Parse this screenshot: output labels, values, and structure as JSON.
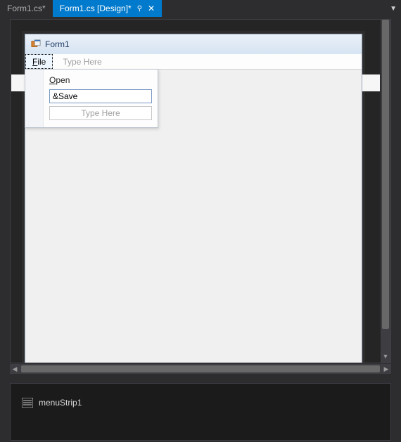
{
  "tabs": {
    "inactive": "Form1.cs*",
    "active": "Form1.cs [Design]*"
  },
  "form": {
    "title": "Form1"
  },
  "menustrip": {
    "file_prefix": "F",
    "file_label": "ile",
    "placeholder": "Type Here"
  },
  "dropdown": {
    "open_prefix": "O",
    "open_label": "pen",
    "save_input": "&Save",
    "placeholder": "Type Here"
  },
  "toolstrip": {
    "placeholder": "Type Here"
  },
  "tray": {
    "component": "menuStrip1"
  }
}
